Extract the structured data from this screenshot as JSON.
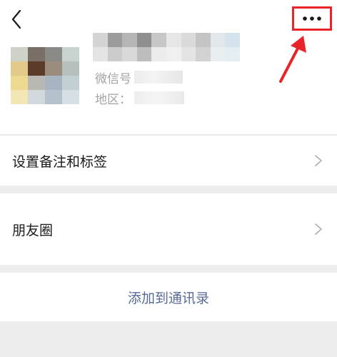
{
  "header": {
    "back_icon": "chevron-left-icon",
    "more_icon": "more-dots-icon",
    "highlight_color": "#e8232a"
  },
  "profile": {
    "wechat_id_label": "微信号",
    "region_label": "地区："
  },
  "menu": {
    "remark_tags_label": "设置备注和标签",
    "moments_label": "朋友圈",
    "chevron_icon": "chevron-right-icon"
  },
  "actions": {
    "add_to_contacts_label": "添加到通讯录",
    "link_color": "#576b95"
  }
}
